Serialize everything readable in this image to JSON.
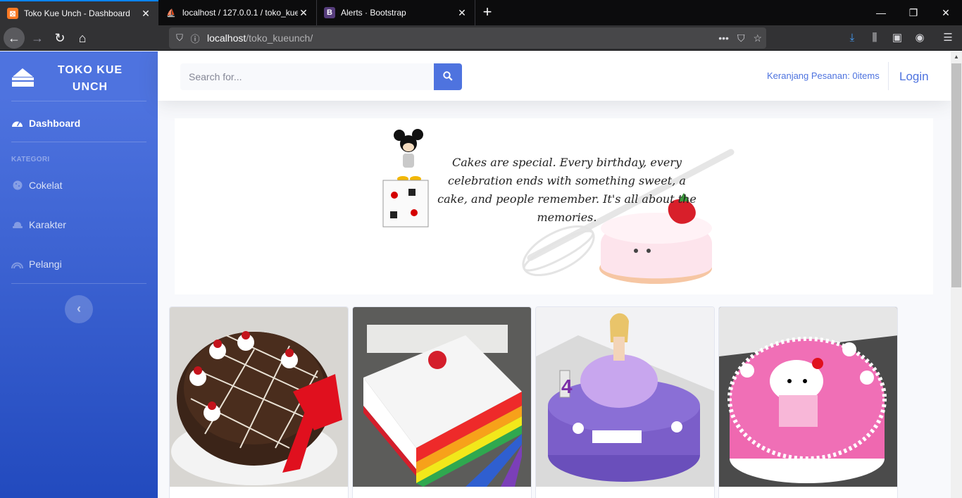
{
  "browser": {
    "tabs": [
      {
        "title": "Toko Kue Unch - Dashboard",
        "favicon": "xampp-icon"
      },
      {
        "title": "localhost / 127.0.0.1 / toko_kue",
        "favicon": "phpmyadmin-icon"
      },
      {
        "title": "Alerts · Bootstrap",
        "favicon": "bootstrap-icon"
      }
    ],
    "url_host": "localhost",
    "url_path": "/toko_kueunch/"
  },
  "sidebar": {
    "brand": "TOKO KUE UNCH",
    "dashboard_label": "Dashboard",
    "heading": "KATEGORI",
    "items": [
      {
        "label": "Cokelat",
        "icon": "cookie-icon"
      },
      {
        "label": "Karakter",
        "icon": "hat-icon"
      },
      {
        "label": "Pelangi",
        "icon": "rainbow-icon"
      }
    ],
    "toggle_symbol": "‹"
  },
  "topbar": {
    "search_placeholder": "Search for...",
    "cart_label": "Keranjang Pesanan: 0items",
    "login_label": "Login"
  },
  "banner": {
    "quote": "Cakes are special. Every birthday, every celebration ends with something sweet, a cake, and people remember. It's all about the memories."
  },
  "products": [
    {
      "name": "Black forest cake",
      "colors": {
        "top": "#3b2418",
        "accent": "#ffffff"
      }
    },
    {
      "name": "Rainbow cake",
      "colors": {
        "top": "#f4f4f4",
        "accent": "#d41e2b"
      }
    },
    {
      "name": "Barbie cake",
      "colors": {
        "top": "#7b5ec9",
        "accent": "#c8a6ee"
      }
    },
    {
      "name": "Hello Kitty cake",
      "colors": {
        "top": "#f06fb6",
        "accent": "#ffffff"
      }
    }
  ]
}
